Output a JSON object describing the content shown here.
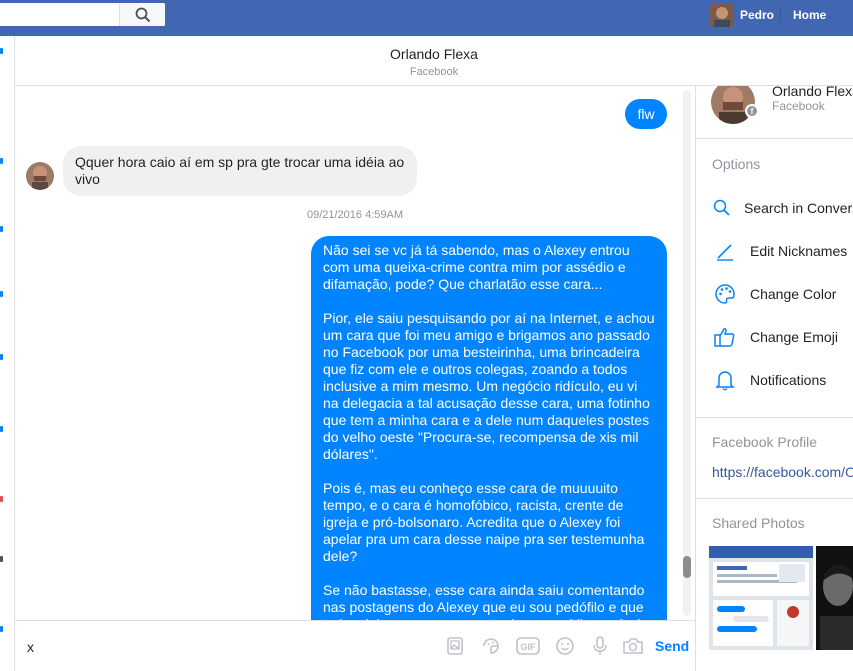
{
  "topbar": {
    "profile_name": "Pedro",
    "home_label": "Home"
  },
  "conversation": {
    "title": "Orlando Flexa",
    "subtitle": "Facebook",
    "messages": {
      "outgoing_short": "flw",
      "incoming": "Qquer hora caio aí em sp pra gte trocar uma idéia ao vivo",
      "timestamp": "09/21/2016 4:59AM",
      "outgoing_long": [
        "Não sei se vc já tá sabendo, mas o Alexey entrou com uma queixa-crime contra mim por assédio e difamação, pode? Que charlatão esse cara...",
        "Pior, ele saiu pesquisando por aí na Internet, e achou um cara que foi meu amigo e brigamos ano passado no Facebook por uma besteirinha, uma brincadeira que fiz com ele e outros colegas, zoando a todos inclusive a mim mesmo. Um negócio ridículo, eu vi na delegacia a tal acusação desse cara, uma fotinho que tem a minha cara e a dele num daqueles postes do velho oeste \"Procura-se, recompensa de xis mil dólares\".",
        "Pois é, mas eu conheço esse cara de muuuuito tempo, e o cara é homofóbico, racista, crente de igreja e pró-bolsonaro. Acredita que o Alexey foi apelar pra um cara desse naipe pra ser testemunha dele?",
        "Se não bastasse, esse cara ainda saiu comentando nas postagens do Alexey que eu sou pedófilo e que traio minha esposa com outro homem. Olha o nível que o cara se rebaixou pra querer me ferrar."
      ]
    }
  },
  "composer": {
    "input_value": "x",
    "send_label": "Send",
    "icons": [
      "photo-icon",
      "sticker-icon",
      "gif-icon",
      "emoji-icon",
      "microphone-icon",
      "camera-icon"
    ]
  },
  "right_panel": {
    "name": "Orlando Flexa",
    "subtitle": "Facebook",
    "badge": "f",
    "options_title": "Options",
    "options": [
      {
        "label": "Search in Conversation",
        "icon": "search-icon"
      },
      {
        "label": "Edit Nicknames",
        "icon": "pencil-icon"
      },
      {
        "label": "Change Color",
        "icon": "palette-icon"
      },
      {
        "label": "Change Emoji",
        "icon": "thumbs-up-icon"
      },
      {
        "label": "Notifications",
        "icon": "bell-icon"
      }
    ],
    "profile_title": "Facebook Profile",
    "profile_link": "https://facebook.com/OrlandoFlexa",
    "shared_photos_title": "Shared Photos"
  },
  "colors": {
    "topbar": "#4267b2",
    "messenger_blue": "#0084ff",
    "incoming_bubble": "#f1f0f0",
    "muted_text": "#90949c"
  }
}
